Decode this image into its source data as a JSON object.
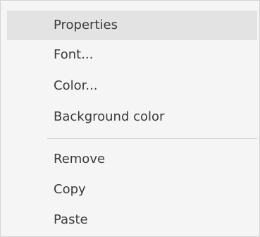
{
  "context_menu": {
    "groups": [
      {
        "items": [
          {
            "label": "Properties",
            "highlighted": true
          },
          {
            "label": "Font..."
          },
          {
            "label": "Color..."
          },
          {
            "label": "Background color"
          }
        ]
      },
      {
        "items": [
          {
            "label": "Remove"
          },
          {
            "label": "Copy"
          },
          {
            "label": "Paste"
          }
        ]
      }
    ]
  },
  "colors": {
    "menu_background": "#f5f5f5",
    "highlight": "#e3e3e3",
    "separator": "#d2d2d2",
    "text": "#3a3a3a"
  }
}
